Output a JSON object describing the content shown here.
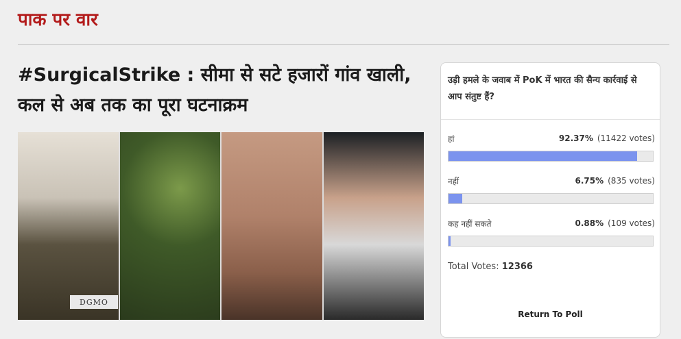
{
  "section": {
    "title": "पाक पर वार"
  },
  "article": {
    "headline": "#SurgicalStrike : सीमा से सटे हजारों गांव खाली, कल से अब तक का पूरा घटनाक्रम",
    "image_caption_text": "DGMO"
  },
  "poll": {
    "question": "उड़ी हमले के जवाब में PoK में भारत की सैन्य कार्रवाई से आप संतुष्ट हैं?",
    "answers": [
      {
        "label": "हां",
        "percent": "92.37%",
        "votes": "(11422 votes)",
        "fraction": 0.9237
      },
      {
        "label": "नहीं",
        "percent": "6.75%",
        "votes": "(835 votes)",
        "fraction": 0.0675
      },
      {
        "label": "कह नहीं सकते",
        "percent": "0.88%",
        "votes": "(109 votes)",
        "fraction": 0.0088
      }
    ],
    "total_label": "Total Votes:",
    "total_value": "12366",
    "return_label": "Return To Poll",
    "bar_color": "#7b93ee"
  }
}
